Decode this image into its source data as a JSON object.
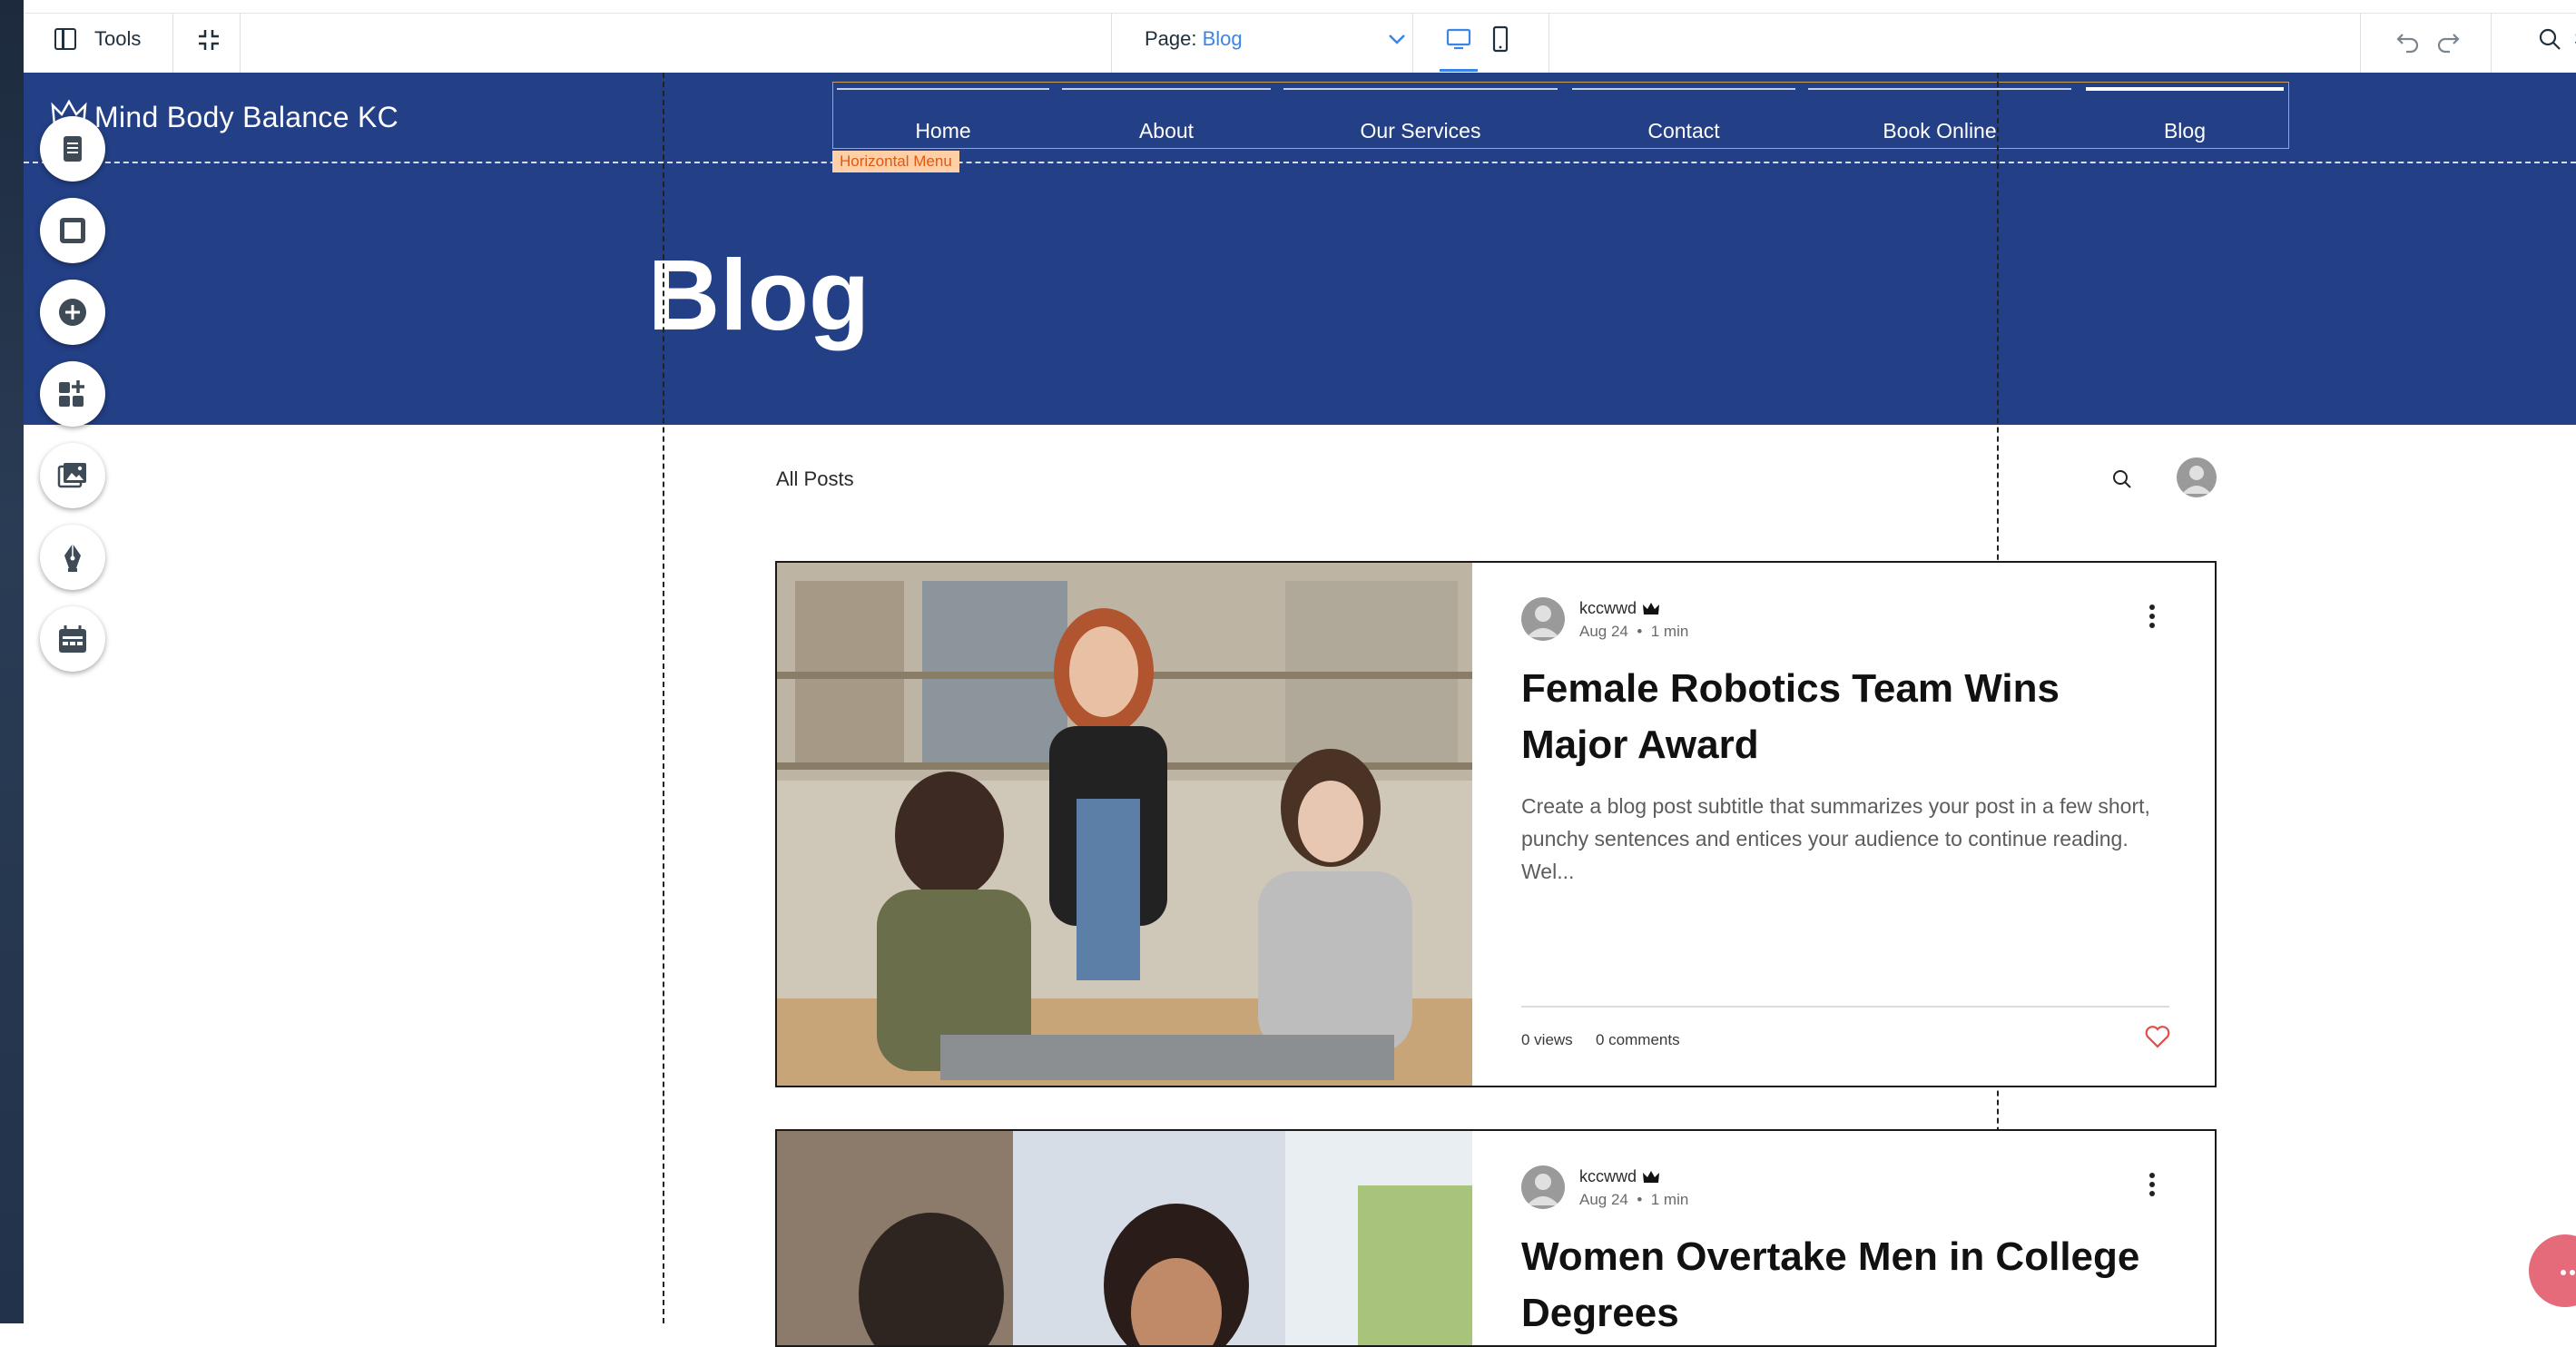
{
  "editor": {
    "tools_label": "Tools",
    "page_label": "Page: ",
    "page_value": "Blog",
    "search_label": "Se"
  },
  "site": {
    "name": "Mind Body Balance KC",
    "menu_tag": "Horizontal Menu",
    "menu": [
      "Home",
      "About",
      "Our Services",
      "Contact",
      "Book Online",
      "Blog"
    ],
    "active_menu": "Blog",
    "hero_title": "Blog",
    "colors": {
      "header_bg": "#233f85",
      "accent": "#3b85e8"
    }
  },
  "blog": {
    "all_posts": "All Posts",
    "posts": [
      {
        "author": "kccwwd",
        "date": "Aug 24",
        "read_time": "1 min",
        "title": "Female Robotics Team Wins Major Award",
        "subtitle": "Create a blog post subtitle that summarizes your post in a few short, punchy sentences and entices your audience to continue reading. Wel...",
        "views": "0 views",
        "comments": "0 comments"
      },
      {
        "author": "kccwwd",
        "date": "Aug 24",
        "read_time": "1 min",
        "title": "Women Overtake Men in College Degrees"
      }
    ]
  },
  "icons": {
    "left_tools": [
      "pages-icon",
      "frame-icon",
      "add-icon",
      "add-apps-icon",
      "media-icon",
      "pen-icon",
      "calendar-icon"
    ]
  }
}
